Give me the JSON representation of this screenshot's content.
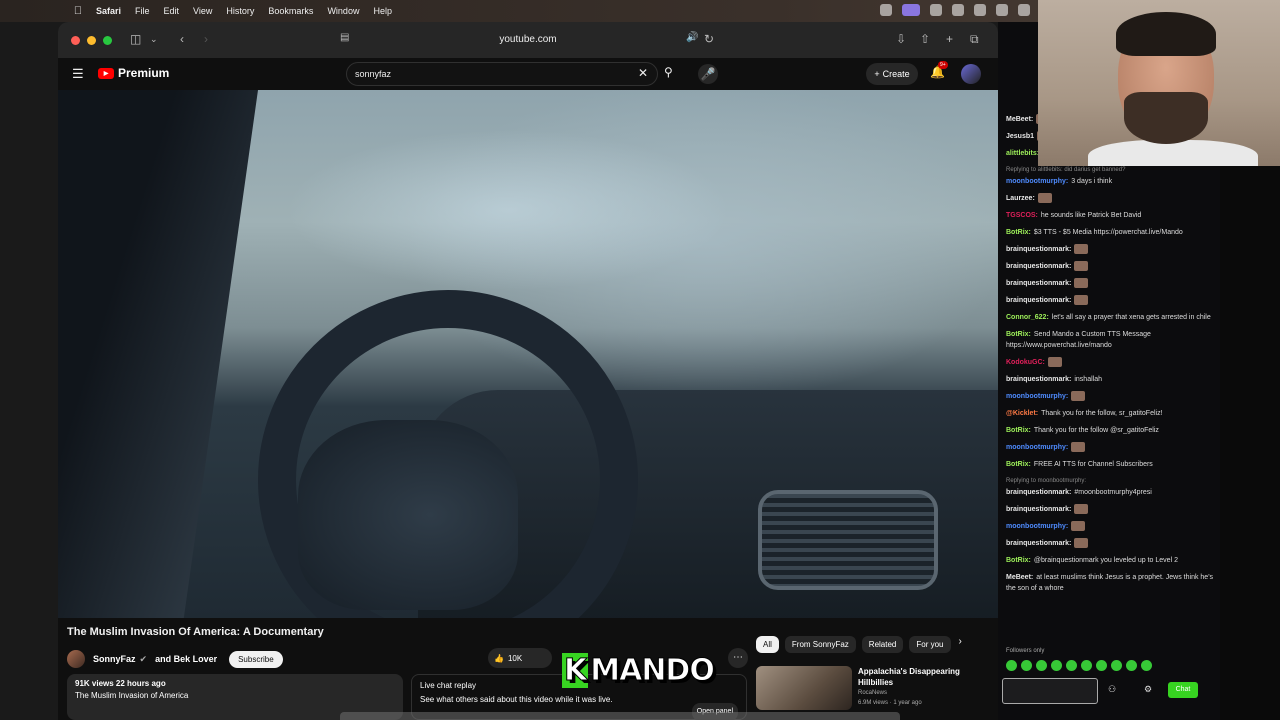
{
  "menubar": {
    "app": "Safari",
    "items": [
      "File",
      "Edit",
      "View",
      "History",
      "Bookmarks",
      "Window",
      "Help"
    ]
  },
  "browser": {
    "url": "youtube.com"
  },
  "youtube": {
    "logo_text": "Premium",
    "search_value": "sonnyfaz",
    "create_label": "Create",
    "notifications_badge": "9+",
    "video_title": "The Muslim Invasion Of America: A Documentary",
    "channel": "SonnyFaz",
    "collab": "and Bek Lover",
    "subscribe_label": "Subscribe",
    "likes": "10K",
    "views_line": "91K views  22 hours ago",
    "desc_first_line": "The Muslim Invasion of America",
    "live_replay_title": "Live chat replay",
    "live_replay_desc": "See what others said about this video while it was live.",
    "open_panel_label": "Open panel",
    "chips": [
      "All",
      "From SonnyFaz",
      "Related",
      "For you"
    ],
    "rec_title": "Appalachia's Disappearing Hillbillies",
    "rec_channel": "RocaNews",
    "rec_meta": "6.9M views · 1 year ago"
  },
  "overlay": {
    "logo_k": "K",
    "logo_rest": "MANDO"
  },
  "chat": {
    "lines": [
      {
        "user": "MeBeet:",
        "text": "",
        "color": "#e8e8e8"
      },
      {
        "user": "Jesusb1",
        "text": "",
        "color": "#e8e8e8"
      },
      {
        "user": "alittlebits:",
        "text": "",
        "color": "#9ef05a"
      },
      {
        "reply": "Replying to alittlebits: did darius get banned?",
        "user": "moonbootmurphy:",
        "text": "3 days i think",
        "color": "#4f8cff"
      },
      {
        "user": "Laurzee:",
        "text": "",
        "color": "#e8e8e8"
      },
      {
        "user": "TGSCOS:",
        "text": "he sounds like Patrick Bet David",
        "color": "#e0205a"
      },
      {
        "user": "BotRix:",
        "text": "$3 TTS - $5 Media https://powerchat.live/Mando",
        "color": "#9ef05a"
      },
      {
        "user": "brainquestionmark:",
        "text": "",
        "color": "#e8e8e8"
      },
      {
        "user": "brainquestionmark:",
        "text": "",
        "color": "#e8e8e8"
      },
      {
        "user": "brainquestionmark:",
        "text": "",
        "color": "#e8e8e8"
      },
      {
        "user": "brainquestionmark:",
        "text": "",
        "color": "#e8e8e8"
      },
      {
        "user": "Connor_622:",
        "text": "let's all say a prayer that xena gets arrested in chile",
        "color": "#9ef05a"
      },
      {
        "user": "BotRix:",
        "text": "Send Mando a Custom TTS Message https://www.powerchat.live/mando",
        "color": "#9ef05a"
      },
      {
        "user": "KodokuGC:",
        "text": "",
        "color": "#e0205a"
      },
      {
        "user": "brainquestionmark:",
        "text": "inshallah",
        "color": "#e8e8e8"
      },
      {
        "user": "moonbootmurphy:",
        "text": "",
        "color": "#4f8cff"
      },
      {
        "user": "@Kicklet:",
        "text": "Thank you for the follow, sr_gatitoFeliz!",
        "color": "#ff7a45"
      },
      {
        "user": "BotRix:",
        "text": "Thank you for the follow @sr_gatitoFeliz",
        "color": "#9ef05a"
      },
      {
        "user": "moonbootmurphy:",
        "text": "",
        "color": "#4f8cff"
      },
      {
        "user": "BotRix:",
        "text": "FREE AI TTS for Channel Subscribers",
        "color": "#9ef05a"
      },
      {
        "reply": "Replying to moonbootmurphy:",
        "user": "brainquestionmark:",
        "text": "#moonbootmurphy4presi",
        "color": "#e8e8e8"
      },
      {
        "user": "brainquestionmark:",
        "text": "",
        "color": "#e8e8e8"
      },
      {
        "user": "moonbootmurphy:",
        "text": "",
        "color": "#4f8cff"
      },
      {
        "user": "brainquestionmark:",
        "text": "",
        "color": "#e8e8e8"
      },
      {
        "user": "BotRix:",
        "text": "@brainquestionmark you leveled up to Level 2",
        "color": "#9ef05a"
      },
      {
        "user": "MeBeet:",
        "text": "at least muslims think Jesus is a prophet. Jews think he's the son of a whore",
        "color": "#e8e8e8"
      }
    ],
    "followers_only": "Followers only",
    "chat_button": "Chat"
  },
  "colors": {
    "accent_green": "#37d421",
    "yt_red": "#ff0000"
  }
}
